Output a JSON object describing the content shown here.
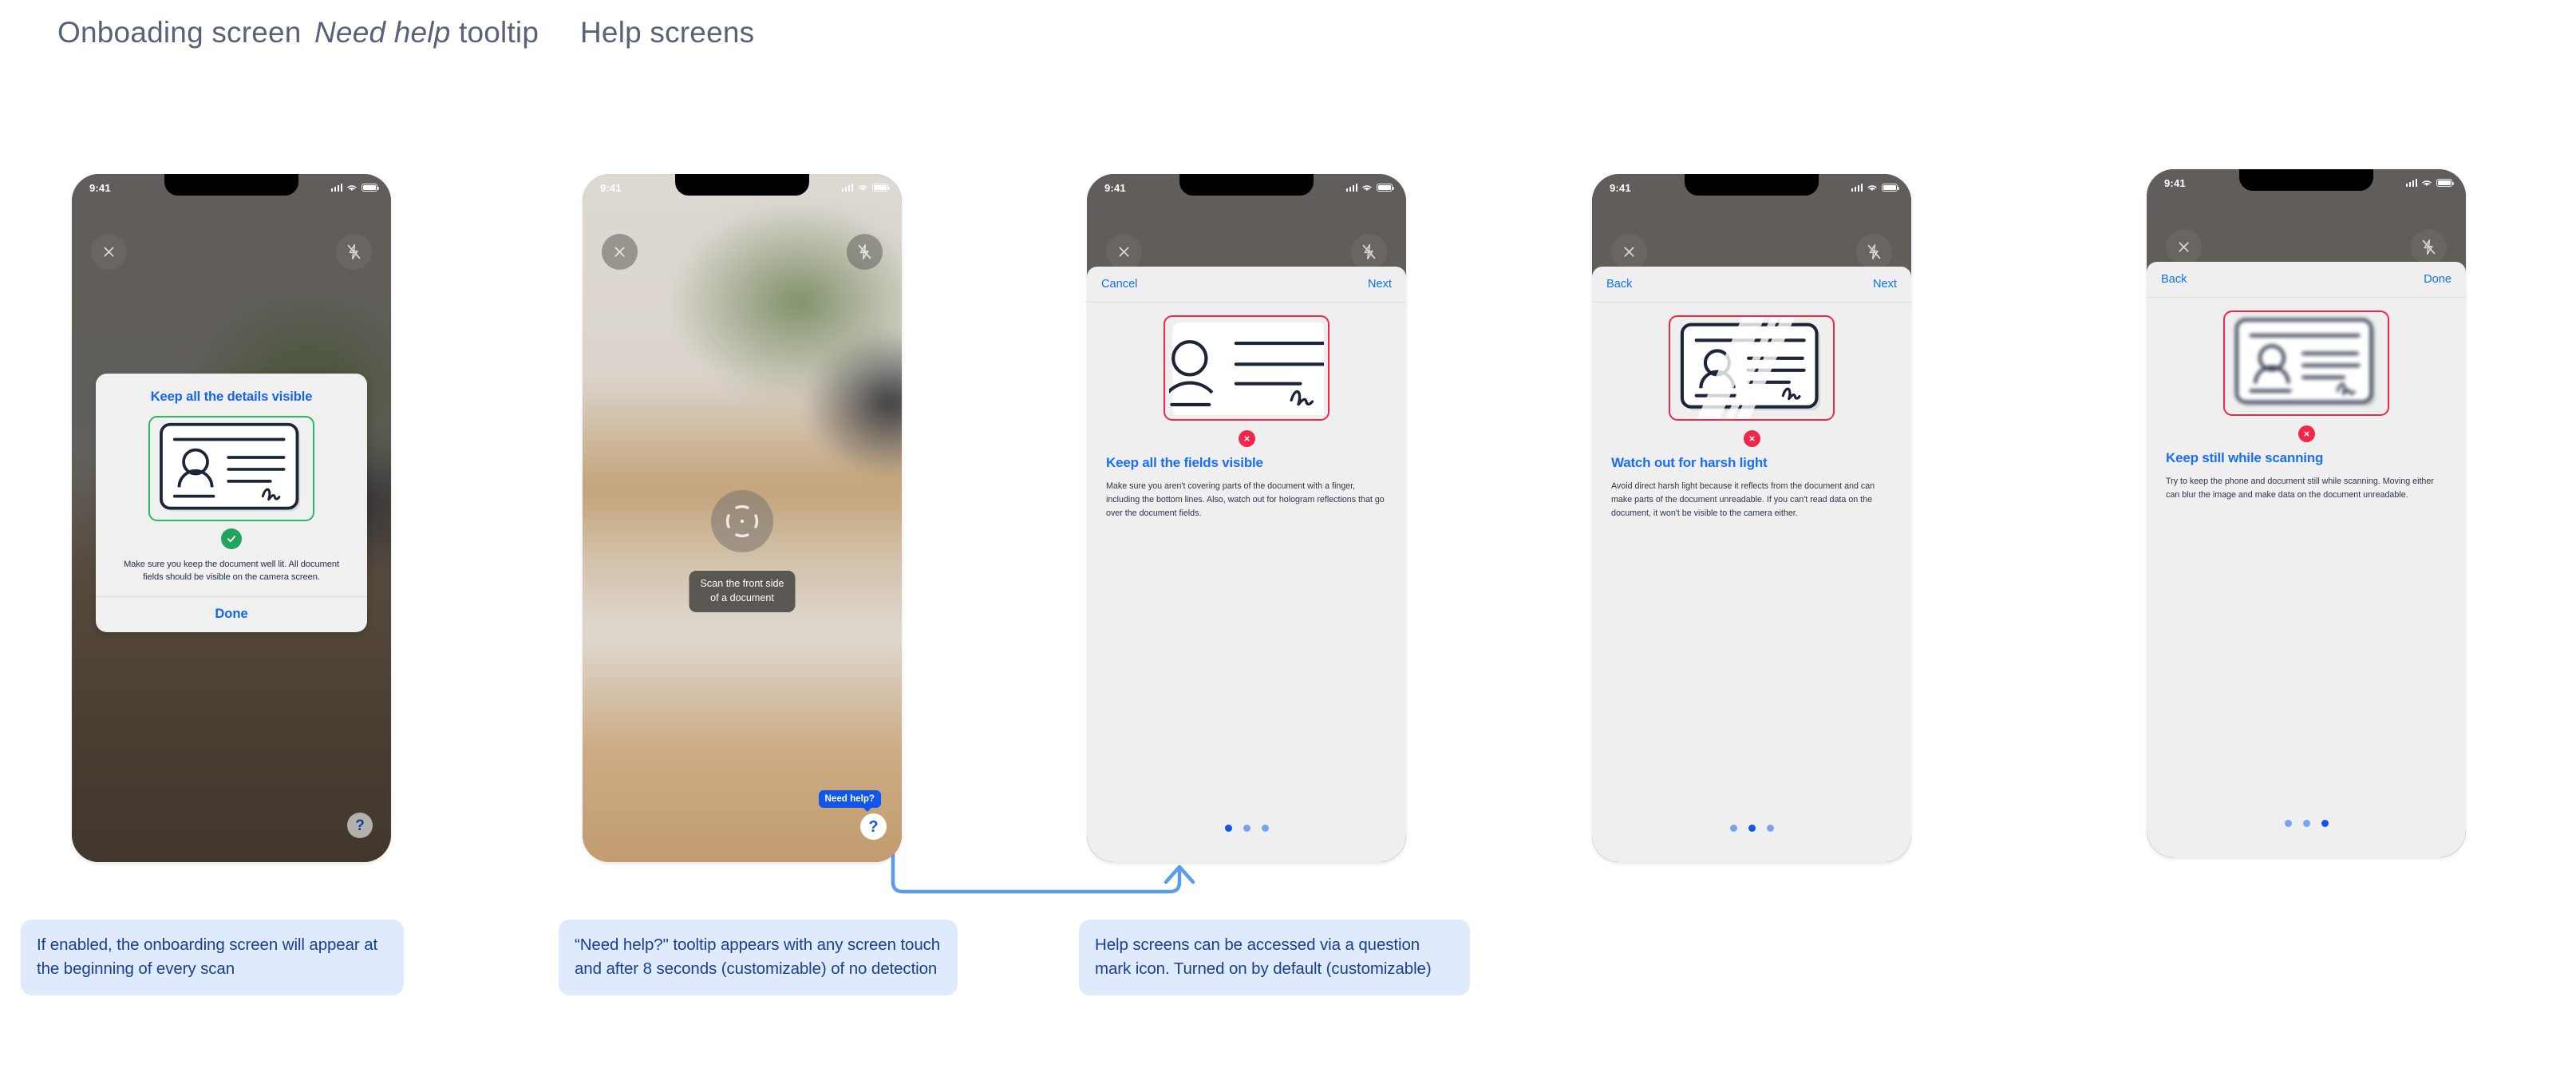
{
  "sections": [
    {
      "label_em": "",
      "label": "Onboading screen"
    },
    {
      "label_em": "Need help",
      "label": " tooltip"
    },
    {
      "label_em": "",
      "label": "Help screens"
    }
  ],
  "status_bar": {
    "time": "9:41"
  },
  "onboarding": {
    "title": "Keep all the details visible",
    "body": "Make sure you keep the document well lit. All document fields should be visible on the camera screen.",
    "done_label": "Done",
    "help_icon": "?",
    "check_icon": "check-icon",
    "close_icon": "close-icon",
    "flash_icon": "flash-off-icon"
  },
  "tooltip_screen": {
    "scan_hint": "Scan the front side\nof a document",
    "need_help_label": "Need help?",
    "help_icon": "?",
    "focus_icon": "focus-reticle-icon"
  },
  "help_screens": [
    {
      "nav_left": "Cancel",
      "nav_right": "Next",
      "heading": "Keep all the fields visible",
      "body": "Make sure you aren't covering parts of the document with a finger, including the bottom lines. Also, watch out for hologram reflections that go over the document fields.",
      "state_icon": "fail-icon",
      "frame_color": "#f0274b",
      "active_dot": 0,
      "dot_count": 3,
      "illustration": "id-card-cropped"
    },
    {
      "nav_left": "Back",
      "nav_right": "Next",
      "heading": "Watch out for harsh light",
      "body": "Avoid direct harsh light because it reflects from the document and can make parts of the document unreadable. If you can't read data on the document, it won't be visible to the camera either.",
      "state_icon": "fail-icon",
      "frame_color": "#f0274b",
      "active_dot": 1,
      "dot_count": 3,
      "illustration": "id-card-glare"
    },
    {
      "nav_left": "Back",
      "nav_right": "Done",
      "heading": "Keep still while scanning",
      "body": "Try to keep the phone and document still while scanning. Moving either can blur the image and make data on the document unreadable.",
      "state_icon": "fail-icon",
      "frame_color": "#f0274b",
      "active_dot": 2,
      "dot_count": 3,
      "illustration": "id-card-blurred"
    }
  ],
  "callouts": [
    {
      "text": "If enabled, the onboarding screen will appear at the beginning of every scan"
    },
    {
      "text": "“Need help?\" tooltip appears with any screen touch and after 8 seconds (customizable) of no detection"
    },
    {
      "text": "Help screens can be accessed via a question mark icon. Turned on by default (customizable)"
    }
  ],
  "colors": {
    "accent_blue": "#1463f3",
    "callout_bg": "#dfeafc",
    "callout_text": "#1b3f93",
    "fail_red": "#f0274b",
    "success_green": "#22a45d",
    "connector": "#5b9bf0"
  }
}
